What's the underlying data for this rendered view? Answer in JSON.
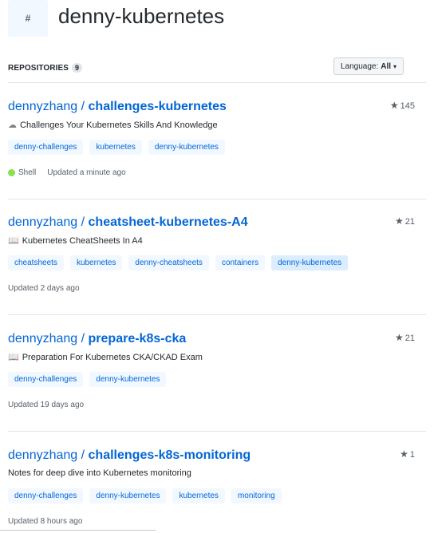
{
  "topic": {
    "badge": "#",
    "title": "denny-kubernetes"
  },
  "repo_bar": {
    "label": "REPOSITORIES",
    "count": "9",
    "language_prefix": "Language:",
    "language_value": "All",
    "caret": "▾"
  },
  "repos": [
    {
      "owner": "dennyzhang",
      "separator": " / ",
      "name": "challenges-kubernetes",
      "stars": "145",
      "desc_icon": "cloud-icon",
      "desc_glyph": "☁",
      "description": "Challenges Your Kubernetes Skills And Knowledge",
      "tags": [
        "denny-challenges",
        "kubernetes",
        "denny-kubernetes"
      ],
      "language": "Shell",
      "language_color": "#89e051",
      "updated": "Updated a minute ago"
    },
    {
      "owner": "dennyzhang",
      "separator": " / ",
      "name": "cheatsheet-kubernetes-A4",
      "stars": "21",
      "desc_icon": "book-icon",
      "desc_glyph": "📖",
      "description": "Kubernetes CheatSheets In A4",
      "tags": [
        "cheatsheets",
        "kubernetes",
        "denny-cheatsheets",
        "containers",
        "denny-kubernetes"
      ],
      "language": "",
      "updated": "Updated 2 days ago"
    },
    {
      "owner": "dennyzhang",
      "separator": " / ",
      "name": "prepare-k8s-cka",
      "stars": "21",
      "desc_icon": "book-icon",
      "desc_glyph": "📖",
      "description": "Preparation For Kubernetes CKA/CKAD Exam",
      "tags": [
        "denny-challenges",
        "denny-kubernetes"
      ],
      "language": "",
      "updated": "Updated 19 days ago"
    },
    {
      "owner": "dennyzhang",
      "separator": " / ",
      "name": "challenges-k8s-monitoring",
      "stars": "1",
      "desc_icon": "",
      "desc_glyph": "",
      "description": "Notes for deep dive into Kubernetes monitoring",
      "tags": [
        "denny-challenges",
        "denny-kubernetes",
        "kubernetes",
        "monitoring"
      ],
      "language": "",
      "updated": "Updated 8 hours ago"
    }
  ],
  "star_glyph": "★",
  "colors": {
    "link": "#0366d6",
    "tag_bg": "#f1f8ff",
    "muted": "#586069"
  }
}
